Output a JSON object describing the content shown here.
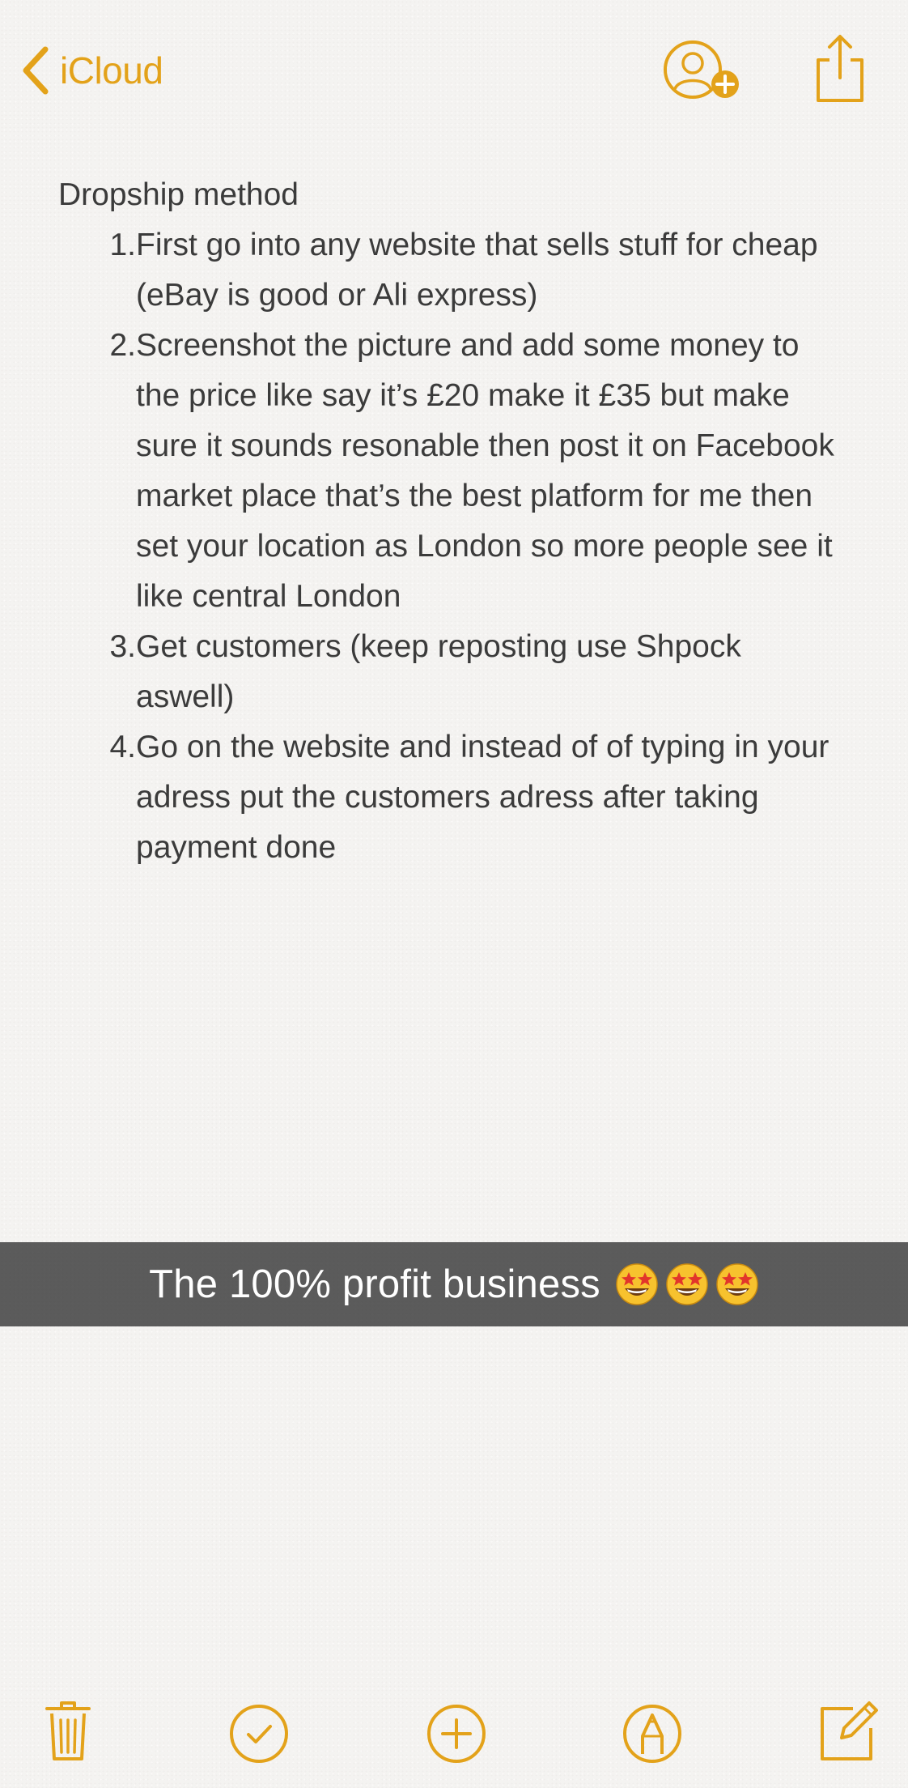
{
  "nav": {
    "back_label": "iCloud",
    "back_icon": "chevron-left-icon",
    "share_person_icon": "add-person-icon",
    "share_icon": "share-icon"
  },
  "note": {
    "title": "Dropship method",
    "steps": [
      {
        "num": "1.",
        "text": "First go into any website that sells stuff for cheap (eBay is good or Ali express)"
      },
      {
        "num": "2.",
        "text": "Screenshot the picture and add some money to the price like say it’s £20 make it £35 but make sure it sounds resonable then post it on Facebook market place that’s the best platform for me then set your location as London so more people see it like central London"
      },
      {
        "num": "3.",
        "text": "Get customers (keep reposting use Shpock aswell)"
      },
      {
        "num": "4.",
        "text": "Go on the website and instead of of typing in your adress put the customers adress after taking payment done"
      }
    ]
  },
  "caption": {
    "text": "The 100% profit business",
    "emojis": [
      "star-struck-emoji",
      "star-struck-emoji",
      "star-struck-emoji"
    ]
  },
  "toolbar": {
    "items": [
      "trash-icon",
      "checklist-icon",
      "add-icon",
      "markup-icon",
      "compose-icon"
    ]
  },
  "colors": {
    "accent": "#e3a21a",
    "text": "#3b3b3b",
    "caption_bg": "#464646",
    "background": "#f4f3f1"
  }
}
